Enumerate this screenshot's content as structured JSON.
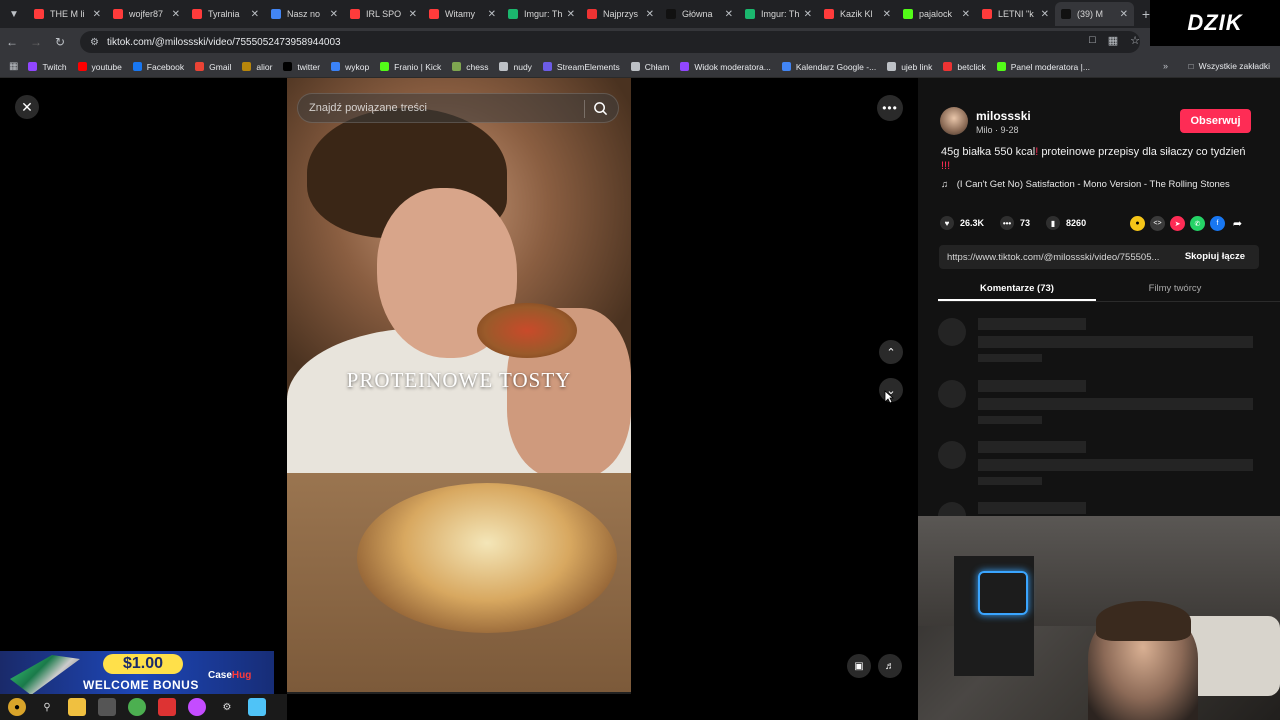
{
  "tabs": [
    {
      "label": "THE M li",
      "color": "#ff3b3b"
    },
    {
      "label": "wojfer87",
      "color": "#ff3b3b"
    },
    {
      "label": "Tyralnia",
      "color": "#ff3b3b"
    },
    {
      "label": "Nasz no",
      "color": "#4285f4"
    },
    {
      "label": "IRL SPO",
      "color": "#ff3b3b"
    },
    {
      "label": "Witamy",
      "color": "#ff3b3b"
    },
    {
      "label": "Imgur: Th",
      "color": "#1bb76e"
    },
    {
      "label": "Najprzys",
      "color": "#e33"
    },
    {
      "label": "Główna",
      "color": "#111"
    },
    {
      "label": "Imgur: Th",
      "color": "#1bb76e"
    },
    {
      "label": "Kazik Kl",
      "color": "#ff3b3b"
    },
    {
      "label": "pajalock",
      "color": "#53fc18"
    },
    {
      "label": "LETNI \"k",
      "color": "#ff3b3b"
    },
    {
      "label": "(39) M",
      "color": "#111"
    }
  ],
  "brand": "DZIK",
  "url": "tiktok.com/@milossski/video/7555052473958944003",
  "bookmarks": [
    {
      "label": "Twitch",
      "color": "#9146ff"
    },
    {
      "label": "youtube",
      "color": "#ff0000"
    },
    {
      "label": "Facebook",
      "color": "#1877f2"
    },
    {
      "label": "Gmail",
      "color": "#ea4335"
    },
    {
      "label": "alior",
      "color": "#b8860b"
    },
    {
      "label": "twitter",
      "color": "#000"
    },
    {
      "label": "wykop",
      "color": "#3b82f6"
    },
    {
      "label": "Franio | Kick",
      "color": "#53fc18"
    },
    {
      "label": "chess",
      "color": "#7fa650"
    },
    {
      "label": "nudy",
      "color": "#bdc1c6"
    },
    {
      "label": "StreamElements",
      "color": "#6c5ce7"
    },
    {
      "label": "Chłam",
      "color": "#bdc1c6"
    },
    {
      "label": "Widok moderatora...",
      "color": "#9146ff"
    },
    {
      "label": "Kalendarz Google -...",
      "color": "#4285f4"
    },
    {
      "label": "ujeb link",
      "color": "#bdc1c6"
    },
    {
      "label": "betclick",
      "color": "#e33"
    },
    {
      "label": "Panel moderatora |...",
      "color": "#53fc18"
    }
  ],
  "all_bookmarks": "Wszystkie zakładki",
  "video": {
    "search_placeholder": "Znajdź powiązane treści",
    "caption": "PROTEINOWE TOSTY"
  },
  "post": {
    "author": "milossski",
    "author_sub": "Milo · 9-28",
    "follow": "Obserwuj",
    "desc_a": "45g białka 550 kcal",
    "desc_b": "proteinowe przepisy dla siłaczy co tydzień",
    "desc_marks": "!",
    "desc_end": "!!!",
    "music": "(I Can't Get No) Satisfaction - Mono Version - The Rolling Stones",
    "likes": "26.3K",
    "comments": "73",
    "saves": "8260",
    "link": "https://www.tiktok.com/@milossski/video/755505...",
    "copy": "Skopiuj łącze",
    "tab_comments": "Komentarze (73)",
    "tab_creator": "Filmy twórcy"
  },
  "promo": {
    "amount": "$1.00",
    "text": "WELCOME BONUS",
    "brand_a": "Case",
    "brand_b": "Hug"
  }
}
